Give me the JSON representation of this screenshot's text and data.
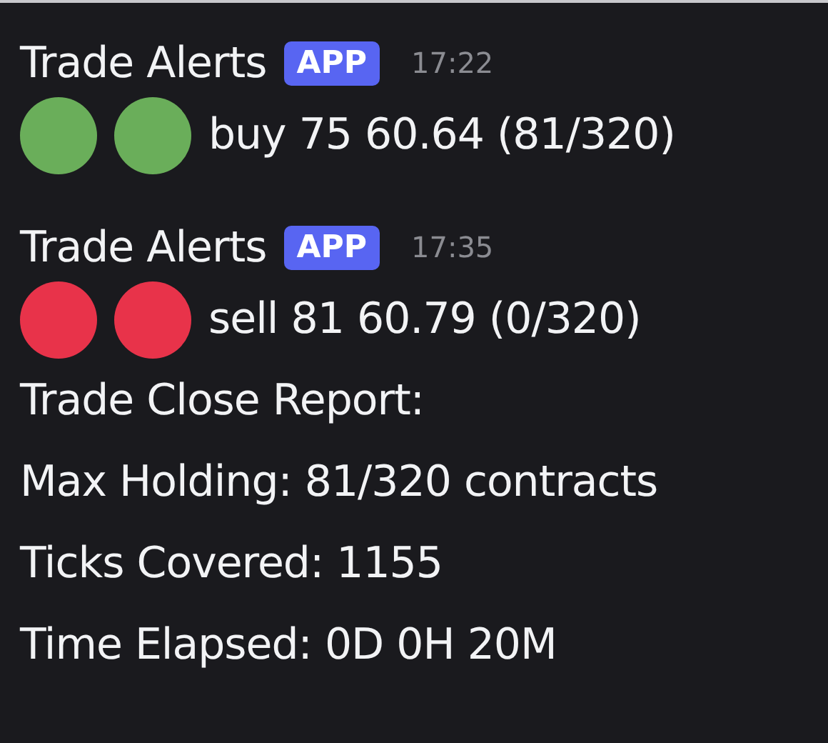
{
  "messages": [
    {
      "author": "Trade Alerts",
      "badge": "APP",
      "time": "17:22",
      "lines": [
        {
          "kind": "signal",
          "dots": [
            {
              "color": "#6aae5a"
            },
            {
              "color": "#6aae5a"
            }
          ],
          "text": "buy 75 60.64 (81/320)"
        }
      ]
    },
    {
      "author": "Trade Alerts",
      "badge": "APP",
      "time": "17:35",
      "lines": [
        {
          "kind": "signal",
          "dots": [
            {
              "color": "#e8334a"
            },
            {
              "color": "#e8334a"
            }
          ],
          "text": "sell 81 60.79 (0/320)"
        },
        {
          "kind": "plain",
          "text": "Trade Close Report:"
        },
        {
          "kind": "plain",
          "text": "Max Holding: 81/320 contracts"
        },
        {
          "kind": "plain",
          "text": "Ticks Covered: 1155"
        },
        {
          "kind": "plain",
          "text": "Time Elapsed: 0D 0H 20M"
        }
      ]
    }
  ]
}
